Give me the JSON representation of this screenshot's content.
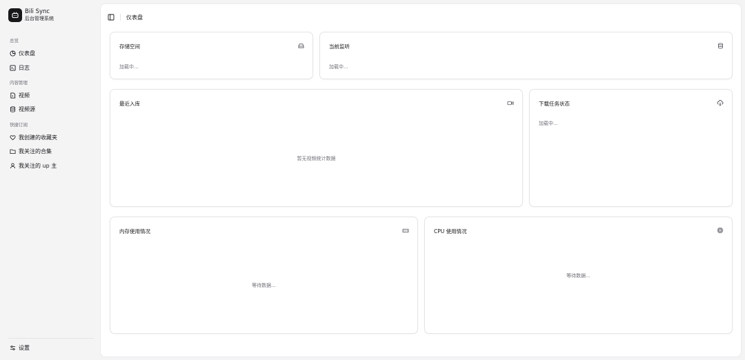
{
  "brand": {
    "name": "Bili Sync",
    "subtitle": "后台管理系统"
  },
  "sidebar": {
    "groups": [
      {
        "label": "总览"
      },
      {
        "label": "内容管理"
      },
      {
        "label": "快捷订阅"
      }
    ],
    "items": [
      {
        "label": "仪表盘",
        "icon": "gauge-icon"
      },
      {
        "label": "日志",
        "icon": "terminal-icon"
      },
      {
        "label": "视频",
        "icon": "file-video-icon"
      },
      {
        "label": "视频源",
        "icon": "database-icon"
      },
      {
        "label": "我创建的收藏夹",
        "icon": "heart-icon"
      },
      {
        "label": "我关注的合集",
        "icon": "folder-icon"
      },
      {
        "label": "我关注的 up 主",
        "icon": "user-icon"
      }
    ],
    "settings": {
      "label": "设置",
      "icon": "sliders-icon"
    }
  },
  "header": {
    "breadcrumb": "仪表盘",
    "toggle_icon": "sidebar-toggle-icon"
  },
  "cards": {
    "storage": {
      "title": "存储空间",
      "status": "加载中...",
      "icon": "hard-drive-icon"
    },
    "monitor": {
      "title": "当前监听",
      "status": "加载中...",
      "icon": "database-icon"
    },
    "recent": {
      "title": "最近入库",
      "status": "暂无视频统计数据",
      "icon": "video-icon"
    },
    "tasks": {
      "title": "下载任务状态",
      "status": "加载中...",
      "icon": "cloud-download-icon"
    },
    "memory": {
      "title": "内存使用情况",
      "status": "等待数据...",
      "icon": "memory-stick-icon"
    },
    "cpu": {
      "title": "CPU 使用情况",
      "status": "等待数据...",
      "icon": "cpu-icon"
    }
  }
}
